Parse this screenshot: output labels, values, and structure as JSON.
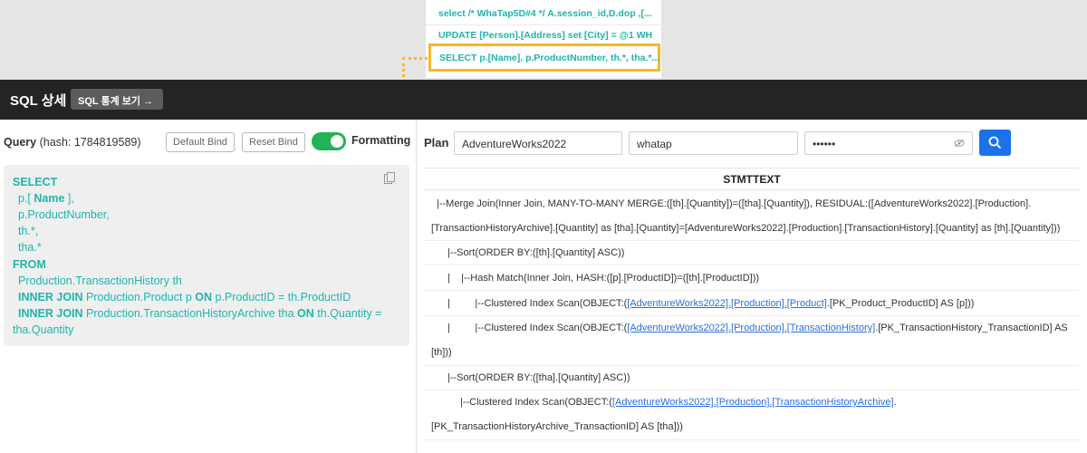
{
  "dropdown": {
    "items": [
      "select /* WhaTap5D#4 */ A.session_id,D.dop ,[...",
      "UPDATE [Person].[Address] set [City] = @1 WH..."
    ],
    "selected": "SELECT p.[Name], p.ProductNumber, th.*, tha.*..."
  },
  "header": {
    "title": "SQL 상세",
    "stats_button": "SQL 통계 보기 →"
  },
  "query": {
    "label": "Query",
    "hash_text": "(hash: 1784819589)",
    "default_bind": "Default Bind",
    "reset_bind": "Reset Bind",
    "formatting": "Formatting",
    "code": {
      "select": "SELECT",
      "c1_pre": "p.[ ",
      "c1_bold": "Name",
      "c1_post": " ],",
      "c2": "p.ProductNumber,",
      "c3": "th.*,",
      "c4": "tha.*",
      "from": "FROM",
      "table1": "Production.TransactionHistory th",
      "join1_kw": "INNER JOIN",
      "join1_table": "Production.Product p",
      "on_kw": "ON",
      "join1_cond": "p.ProductID = th.ProductID",
      "join2_kw": "INNER JOIN",
      "join2_table": "Production.TransactionHistoryArchive tha",
      "join2_cond": "th.Quantity =",
      "join2_cont": "tha.Quantity"
    }
  },
  "plan": {
    "label": "Plan",
    "database": "AdventureWorks2022",
    "user": "whatap",
    "password_mask": "••••••",
    "column_header": "STMTTEXT",
    "lines": {
      "l1": "|--Merge Join(Inner Join, MANY-TO-MANY MERGE:([th].[Quantity])=([tha].[Quantity]), RESIDUAL:([AdventureWorks2022].[Production].",
      "l2": "[TransactionHistoryArchive].[Quantity] as [tha].[Quantity]=[AdventureWorks2022].[Production].[TransactionHistory].[Quantity] as [th].[Quantity]))",
      "l3": "|--Sort(ORDER BY:([th].[Quantity] ASC))",
      "l4": "|    |--Hash Match(Inner Join, HASH:([p].[ProductID])=([th].[ProductID]))",
      "l5_pre": "|         |--Clustered Index Scan(OBJECT:(",
      "l5_link": "[AdventureWorks2022].[Production].[Product]",
      "l5_post": ".[PK_Product_ProductID] AS [p]))",
      "l6_pre": "|         |--Clustered Index Scan(OBJECT:(",
      "l6_link": "[AdventureWorks2022].[Production].[TransactionHistory]",
      "l6_post": ".[PK_TransactionHistory_TransactionID] AS",
      "l7": "[th]))",
      "l8": "|--Sort(ORDER BY:([tha].[Quantity] ASC))",
      "l9_pre": "|--Clustered Index Scan(OBJECT:(",
      "l9_link": "[AdventureWorks2022].[Production].[TransactionHistoryArchive]",
      "l9_post": ".",
      "l10": "[PK_TransactionHistoryArchive_TransactionID] AS [tha]))"
    }
  }
}
